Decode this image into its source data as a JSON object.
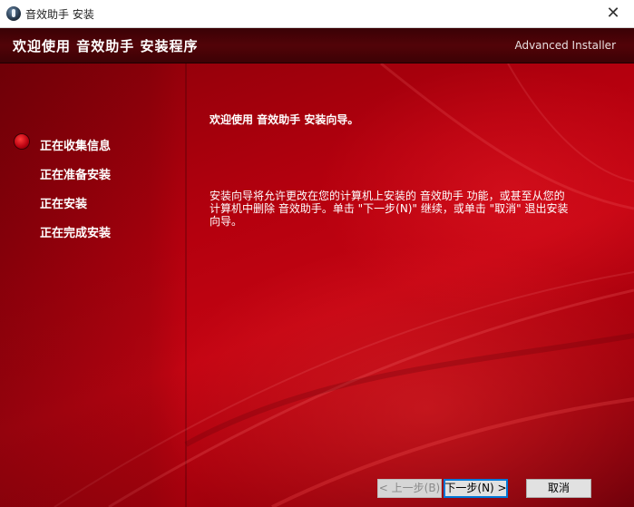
{
  "window": {
    "title": "音效助手 安装",
    "close_glyph": "✕"
  },
  "header": {
    "title": "欢迎使用 音效助手 安装程序",
    "brand": "Advanced Installer"
  },
  "steps": [
    {
      "label": "正在收集信息",
      "active": true
    },
    {
      "label": "正在准备安装",
      "active": false
    },
    {
      "label": "正在安装",
      "active": false
    },
    {
      "label": "正在完成安装",
      "active": false
    }
  ],
  "main": {
    "welcome": "欢迎使用 音效助手 安装向导。",
    "description": "安装向导将允许更改在您的计算机上安装的 音效助手 功能，或甚至从您的计算机中删除 音效助手。单击 \"下一步(N)\" 继续，或单击 \"取消\" 退出安装向导。"
  },
  "buttons": {
    "back": "< 上一步(B)",
    "next": "下一步(N) >",
    "cancel": "取消"
  },
  "colors": {
    "header_bg": "#4a0307",
    "background_red": "#b4000e",
    "accent": "#0078d7"
  }
}
